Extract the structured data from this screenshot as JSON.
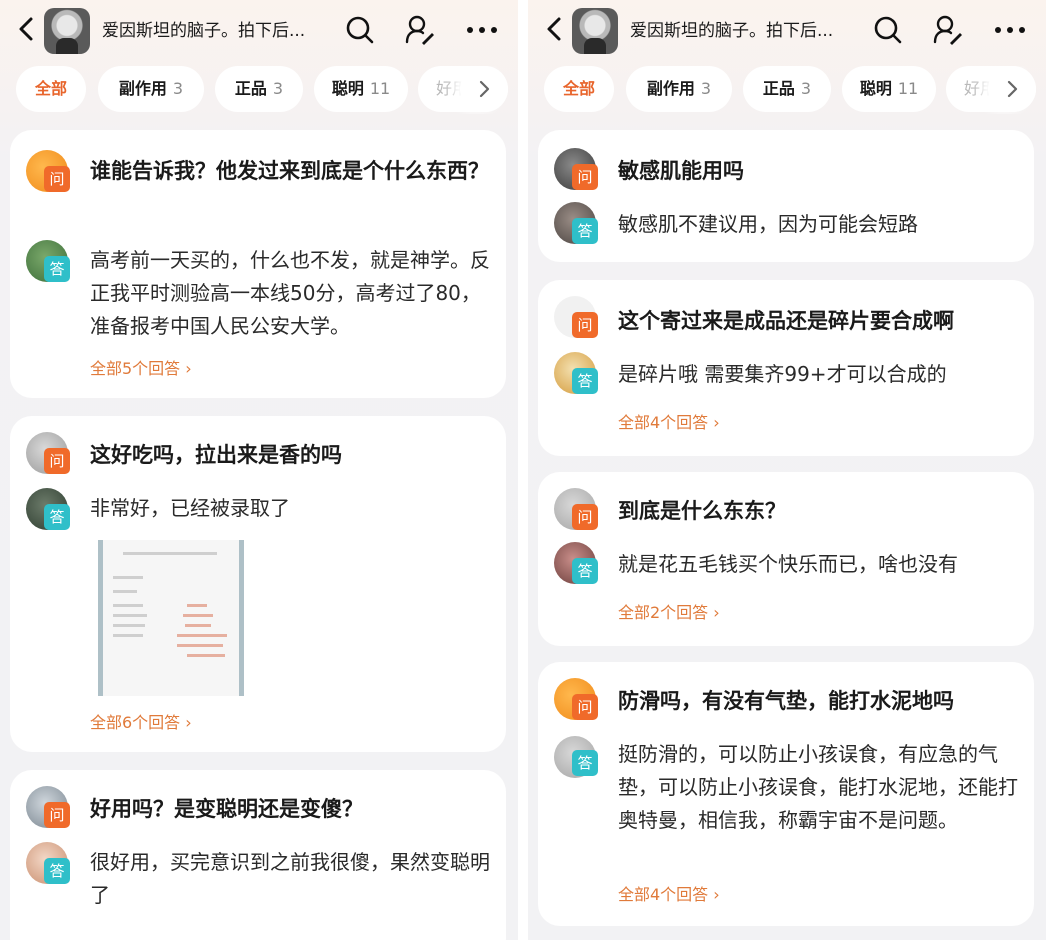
{
  "header": {
    "title": "爱因斯坦的脑子。拍下后..."
  },
  "tabs": [
    {
      "label": "全部",
      "count": ""
    },
    {
      "label": "副作用",
      "count": "3"
    },
    {
      "label": "正品",
      "count": "3"
    },
    {
      "label": "聪明",
      "count": "11"
    },
    {
      "label": "好用",
      "count": ""
    }
  ],
  "colors": {
    "accent": "#e8652c",
    "question_badge": "#f06a2a",
    "answer_badge": "#2fbfc9",
    "link": "#e07a3a"
  },
  "badges": {
    "question": "问",
    "answer": "答"
  },
  "left_panel": {
    "cards": [
      {
        "question": "谁能告诉我？他发过来到底是个什么东西？",
        "answer": "高考前一天买的，什么也不发，就是神学。反正我平时测验高一本线50分，高考过了80，准备报考中国人民公安大学。",
        "more": "全部5个回答 ›"
      },
      {
        "question": "这好吃吗，拉出来是香的吗",
        "answer": "非常好，已经被录取了",
        "has_photo": true,
        "more": "全部6个回答 ›"
      },
      {
        "question": "好用吗？是变聪明还是变傻？",
        "answer": "很好用，买完意识到之前我很傻，果然变聪明了"
      }
    ]
  },
  "right_panel": {
    "cards": [
      {
        "question": "敏感肌能用吗",
        "answer": "敏感肌不建议用，因为可能会短路"
      },
      {
        "question": "这个寄过来是成品还是碎片要合成啊",
        "answer": "是碎片哦 需要集齐99+才可以合成的",
        "more": "全部4个回答 ›"
      },
      {
        "question": "到底是什么东东？",
        "answer": "就是花五毛钱买个快乐而已，啥也没有",
        "more": "全部2个回答 ›"
      },
      {
        "question": "防滑吗，有没有气垫，能打水泥地吗",
        "answer": "挺防滑的，可以防止小孩误食，有应急的气垫，可以防止小孩误食，能打水泥地，还能打奥特曼，相信我，称霸宇宙不是问题。",
        "more": "全部4个回答 ›"
      }
    ]
  }
}
